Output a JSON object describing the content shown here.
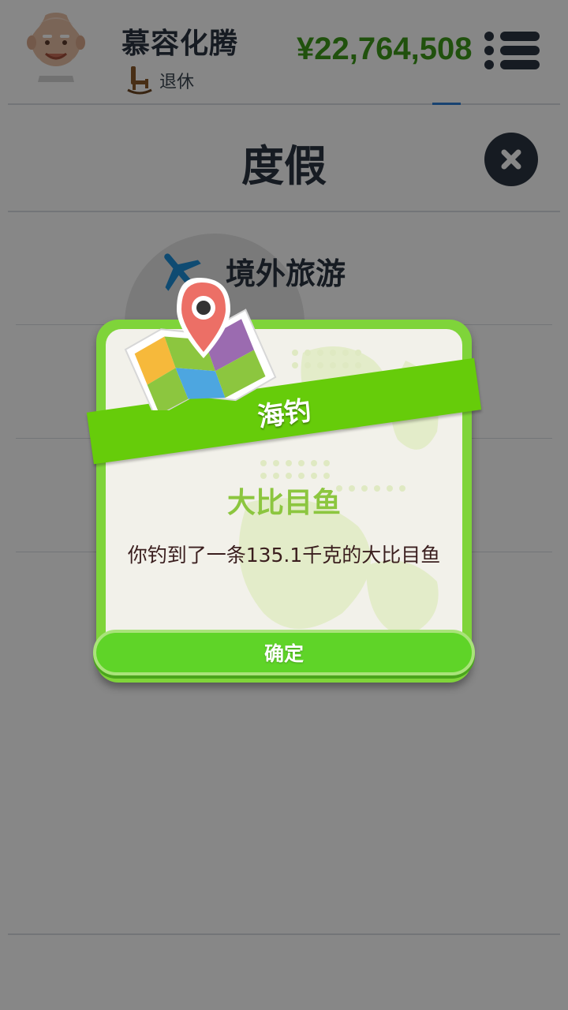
{
  "header": {
    "user_name": "慕容化腾",
    "status_label": "退休",
    "money": "¥22,764,508"
  },
  "section": {
    "title": "度假"
  },
  "options": [
    {
      "label": "境外旅游",
      "icon": "airplane-icon"
    }
  ],
  "popup": {
    "ribbon_title": "海钓",
    "catch_name": "大比目鱼",
    "message": "你钓到了一条135.1千克的大比目鱼",
    "confirm_label": "确定",
    "icon": "map-pin-icon"
  },
  "colors": {
    "money": "#3d9a1a",
    "ribbon": "#66cc0a",
    "catch_name": "#8cc63f",
    "dark_text": "#2b3440",
    "overlay": "rgba(0,0,0,0.47)"
  }
}
